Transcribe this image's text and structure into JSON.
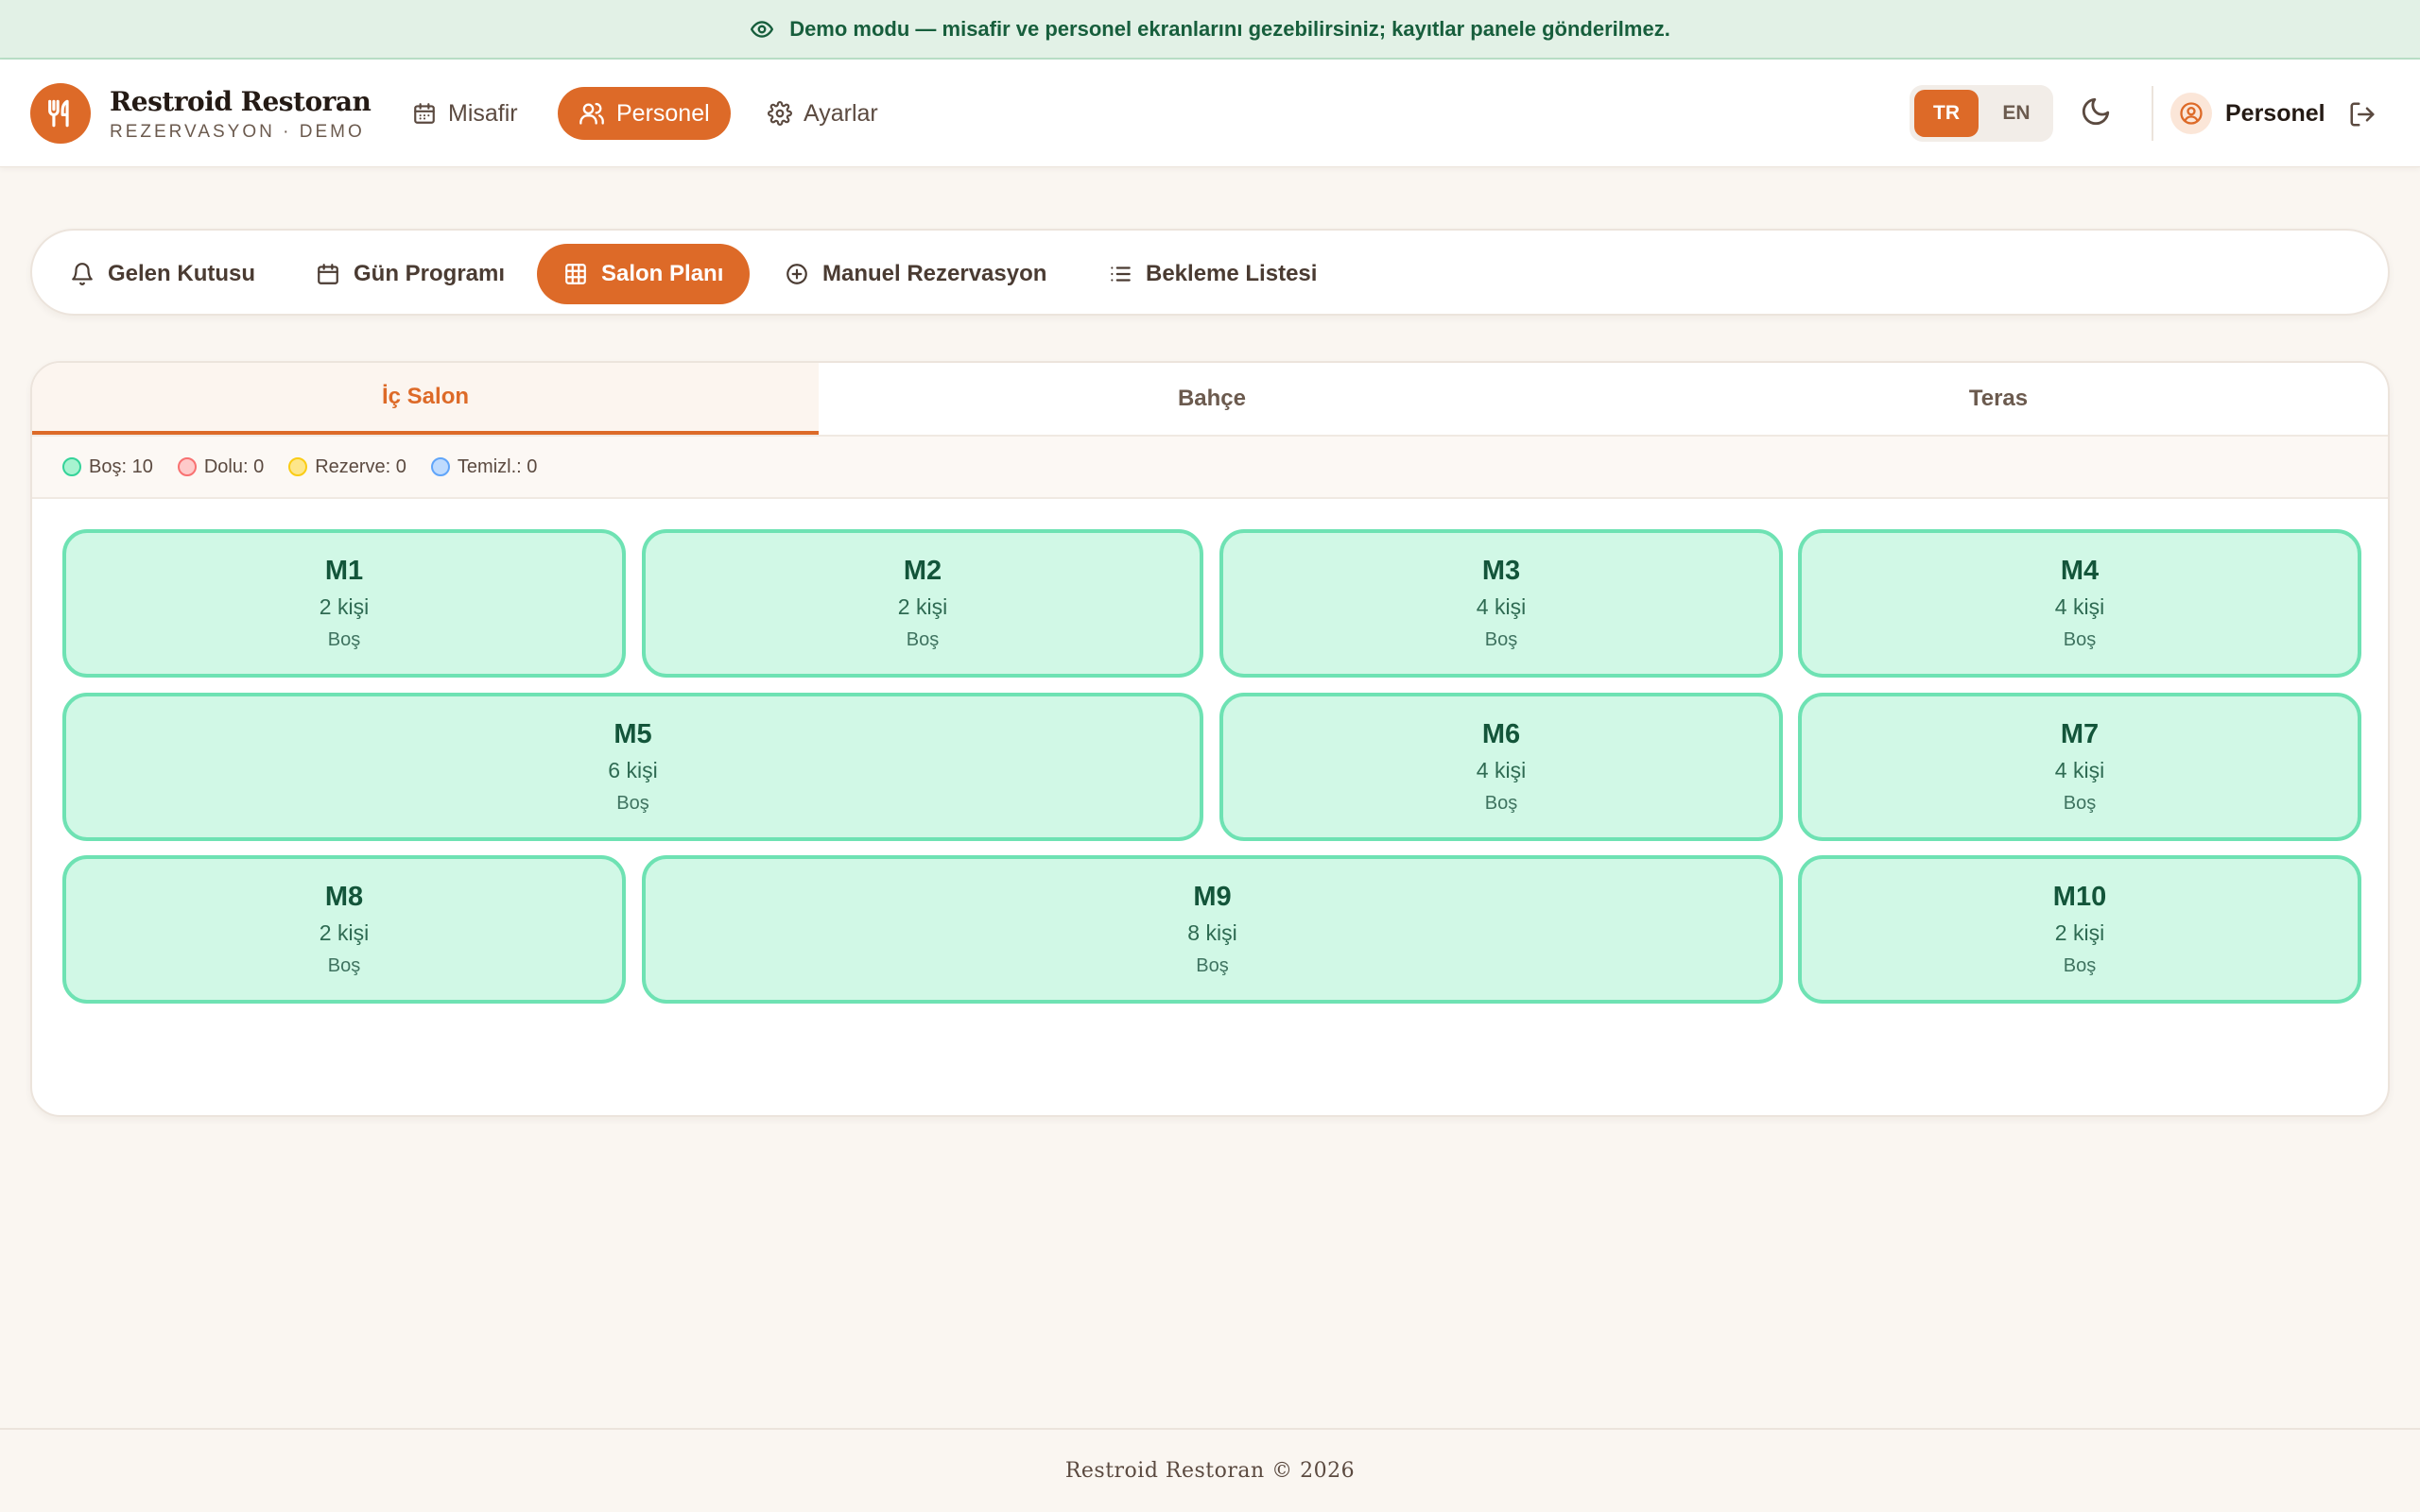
{
  "banner": {
    "icon": "eye-icon",
    "text": "Demo modu — misafir ve personel ekranlarını gezebilirsiniz; kayıtlar panele gönderilmez."
  },
  "header": {
    "brand_name": "Restroid Restoran",
    "brand_sub": "REZERVASYON · DEMO",
    "nav": [
      {
        "label": "Misafir",
        "icon": "calendar-icon",
        "active": false
      },
      {
        "label": "Personel",
        "icon": "users-icon",
        "active": true
      },
      {
        "label": "Ayarlar",
        "icon": "gear-icon",
        "active": false
      }
    ],
    "lang": {
      "tr": "TR",
      "en": "EN",
      "active": "TR"
    },
    "user": "Personel"
  },
  "subnav": [
    {
      "label": "Gelen Kutusu",
      "icon": "bell-icon",
      "active": false
    },
    {
      "label": "Gün Programı",
      "icon": "calendar-icon",
      "active": false
    },
    {
      "label": "Salon Planı",
      "icon": "grid-icon",
      "active": true
    },
    {
      "label": "Manuel Rezervasyon",
      "icon": "plus-circle-icon",
      "active": false
    },
    {
      "label": "Bekleme Listesi",
      "icon": "list-icon",
      "active": false
    }
  ],
  "tabs": [
    {
      "label": "İç Salon",
      "active": true
    },
    {
      "label": "Bahçe",
      "active": false
    },
    {
      "label": "Teras",
      "active": false
    }
  ],
  "legend": [
    {
      "label": "Boş: 10",
      "color": "#34d399"
    },
    {
      "label": "Dolu: 0",
      "color": "#f87171"
    },
    {
      "label": "Rezerve: 0",
      "color": "#facc15"
    },
    {
      "label": "Temizl.: 0",
      "color": "#60a5fa"
    }
  ],
  "tables": [
    {
      "name": "M1",
      "capacity": "2 kişi",
      "status": "Boş"
    },
    {
      "name": "M2",
      "capacity": "2 kişi",
      "status": "Boş"
    },
    {
      "name": "M3",
      "capacity": "4 kişi",
      "status": "Boş"
    },
    {
      "name": "M4",
      "capacity": "4 kişi",
      "status": "Boş"
    },
    {
      "name": "M5",
      "capacity": "6 kişi",
      "status": "Boş"
    },
    {
      "name": "M6",
      "capacity": "4 kişi",
      "status": "Boş"
    },
    {
      "name": "M7",
      "capacity": "4 kişi",
      "status": "Boş"
    },
    {
      "name": "M8",
      "capacity": "2 kişi",
      "status": "Boş"
    },
    {
      "name": "M9",
      "capacity": "8 kişi",
      "status": "Boş"
    },
    {
      "name": "M10",
      "capacity": "2 kişi",
      "status": "Boş"
    }
  ],
  "colors": {
    "accent": "#dd6a28",
    "free_bg": "#d1f8e6",
    "free_border": "#6ee2b3"
  },
  "footer": "Restroid Restoran © 2026"
}
